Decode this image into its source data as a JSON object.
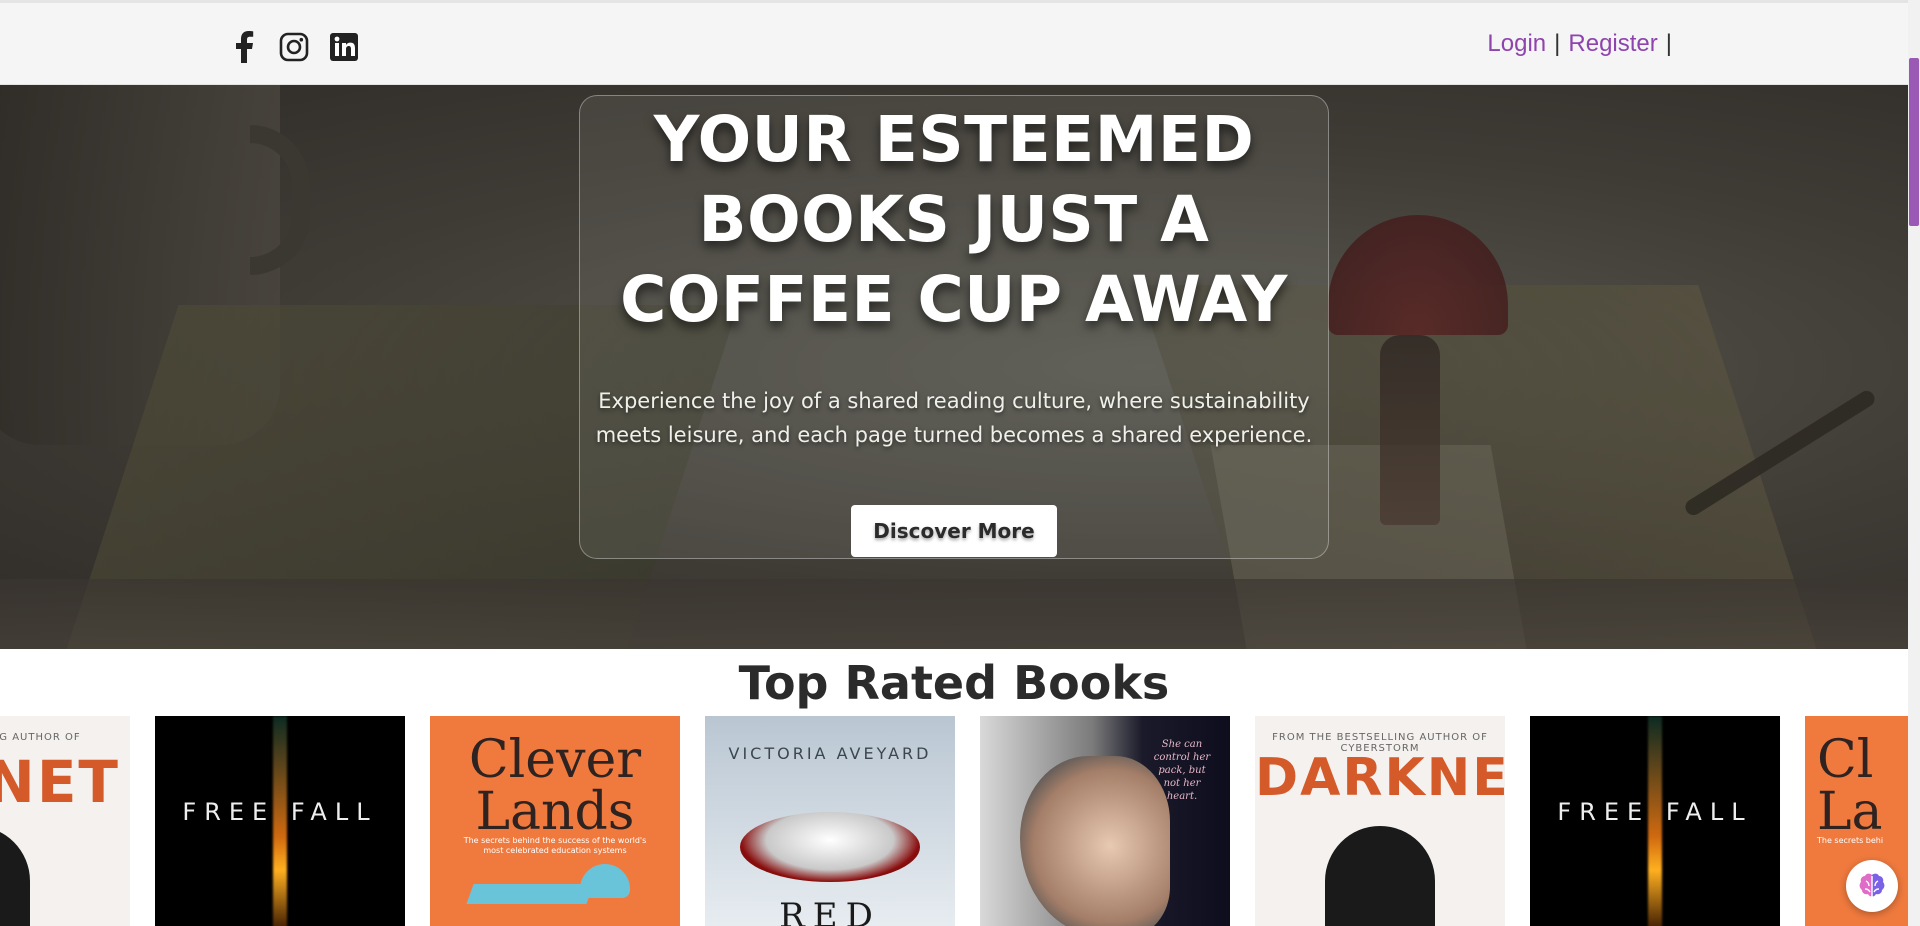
{
  "header": {
    "social": [
      "facebook-icon",
      "instagram-icon",
      "linkedin-icon"
    ],
    "login_label": "Login",
    "register_label": "Register",
    "separator": "|"
  },
  "hero": {
    "title_line1": "YOUR ESTEEMED",
    "title_line2": "BOOKS JUST A",
    "title_line3": "COFFEE CUP AWAY",
    "description_line1": "Experience the joy of a shared reading culture, where sustainability",
    "description_line2": "meets leisure, and each page turned becomes a shared experience.",
    "cta_label": "Discover More"
  },
  "top_rated": {
    "title": "Top Rated Books",
    "books": [
      {
        "kind": "darknet",
        "small": "BESTSELLING AUTHOR OF",
        "title": "KNET"
      },
      {
        "kind": "freefall",
        "title": "FREE FALL"
      },
      {
        "kind": "clever",
        "title": "Clever Lands",
        "sub": "The secrets behind the success of the world's most celebrated education systems"
      },
      {
        "kind": "red",
        "author": "VICTORIA AVEYARD",
        "title": "RED"
      },
      {
        "kind": "wolf",
        "quote": "She can control her pack, but not her heart."
      },
      {
        "kind": "darknet",
        "small": "FROM THE BESTSELLING AUTHOR OF CYBERSTORM",
        "title": "DARKNET"
      },
      {
        "kind": "freefall",
        "title": "FREE FALL"
      },
      {
        "kind": "clever",
        "title": "Cl La",
        "sub": "The secrets behi"
      }
    ]
  },
  "colors": {
    "accent": "#8e44ad",
    "header_bg": "#f5f5f5",
    "text_dark": "#2b2b2b"
  }
}
